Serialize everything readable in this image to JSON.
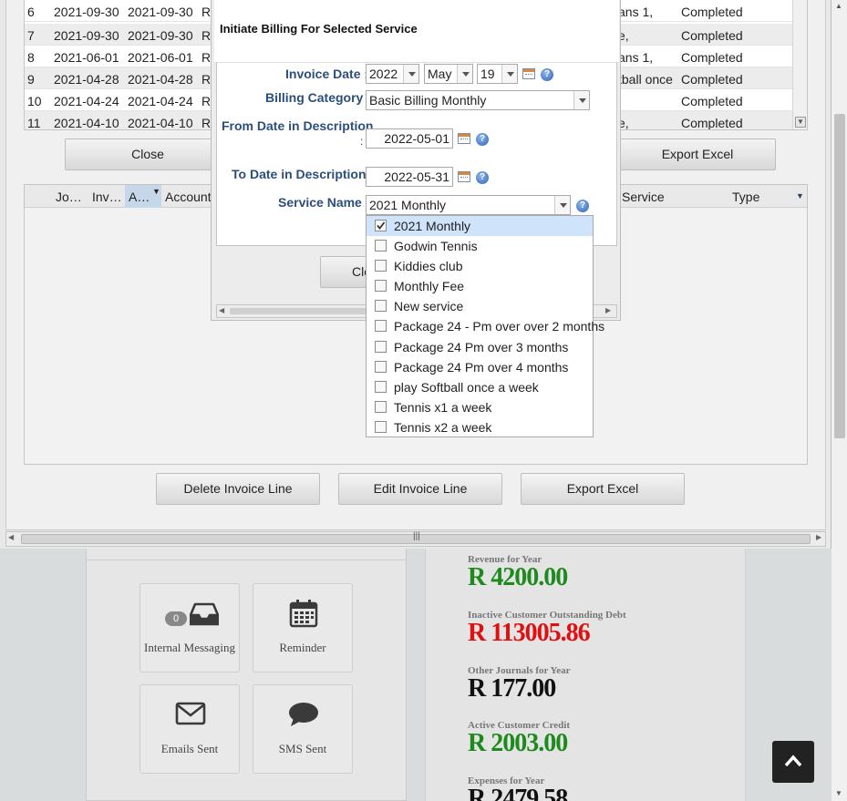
{
  "top_table": {
    "rows": [
      {
        "no": "6",
        "date1": "2021-09-30",
        "date2": "2021-09-30",
        "c": "R",
        "desc": "ans 1,",
        "status": "Completed"
      },
      {
        "no": "7",
        "date1": "2021-09-30",
        "date2": "2021-09-30",
        "c": "R",
        "desc": "e,",
        "status": "Completed"
      },
      {
        "no": "8",
        "date1": "2021-06-01",
        "date2": "2021-06-01",
        "c": "R",
        "desc": "ans 1,",
        "status": "Completed"
      },
      {
        "no": "9",
        "date1": "2021-04-28",
        "date2": "2021-04-28",
        "c": "R",
        "desc": "tball once",
        "status": "Completed"
      },
      {
        "no": "10",
        "date1": "2021-04-24",
        "date2": "2021-04-24",
        "c": "R",
        "desc": "",
        "status": "Completed"
      },
      {
        "no": "11",
        "date1": "2021-04-10",
        "date2": "2021-04-10",
        "c": "R",
        "desc": "e,",
        "status": "Completed"
      }
    ],
    "close_label": "Close",
    "export_label": "Export Excel"
  },
  "lower_table": {
    "headers": {
      "jo": "Jo…",
      "inv": "Inv…",
      "amt": "A…",
      "account": "Account",
      "service": "Service",
      "type": "Type"
    },
    "delete_label": "Delete Invoice Line",
    "edit_label": "Edit Invoice Line",
    "export_label": "Export Excel"
  },
  "modal": {
    "title": "Initiate Billing For Selected Service",
    "invoice_date_label": "Invoice Date :",
    "year": "2022",
    "month": "May",
    "day": "19",
    "billing_category_label": "Billing Category :",
    "billing_category": "Basic Billing Monthly",
    "from_label": "From Date in Description",
    "from_colon": ":",
    "from_date": "2022-05-01",
    "to_label": "To Date in Description :",
    "to_date": "2022-05-31",
    "service_label": "Service Name :",
    "service_value": "2021 Monthly",
    "close_label": "Clo",
    "help_glyph": "?"
  },
  "service_options": [
    {
      "label": "2021 Monthly",
      "checked": true
    },
    {
      "label": "Godwin Tennis",
      "checked": false
    },
    {
      "label": "Kiddies club",
      "checked": false
    },
    {
      "label": "Monthly Fee",
      "checked": false
    },
    {
      "label": "New service",
      "checked": false
    },
    {
      "label": "Package 24 - Pm over over 2 months",
      "checked": false
    },
    {
      "label": "Package 24 Pm over 3 months",
      "checked": false
    },
    {
      "label": "Package 24 Pm over 4 months",
      "checked": false
    },
    {
      "label": "play Softball once a week",
      "checked": false
    },
    {
      "label": "Tennis x1 a week",
      "checked": false
    },
    {
      "label": "Tennis x2 a week",
      "checked": false
    }
  ],
  "dashboard": {
    "tiles": {
      "messaging": "Internal Messaging",
      "messaging_count": "0",
      "reminder": "Reminder",
      "emails": "Emails Sent",
      "sms": "SMS Sent"
    },
    "stats": [
      {
        "label": "Revenue for Year",
        "value": "R 4200.00",
        "color": "#1e8a1e"
      },
      {
        "label": "Inactive Customer Outstanding Debt",
        "value": "R 113005.86",
        "color": "#e01010"
      },
      {
        "label": "Other Journals for Year",
        "value": "R 177.00",
        "color": "#111111"
      },
      {
        "label": "Active Customer Credit",
        "value": "R 2003.00",
        "color": "#1e8a1e"
      },
      {
        "label": "Expenses for Year",
        "value": "R 2479.58",
        "color": "#111111"
      }
    ]
  },
  "icons": {
    "calendar": "calendar-icon",
    "help": "help-icon",
    "inbox": "inbox-icon",
    "envelope": "envelope-icon",
    "chat": "chat-bubble-icon",
    "arrow_up": "arrow-up-icon"
  }
}
